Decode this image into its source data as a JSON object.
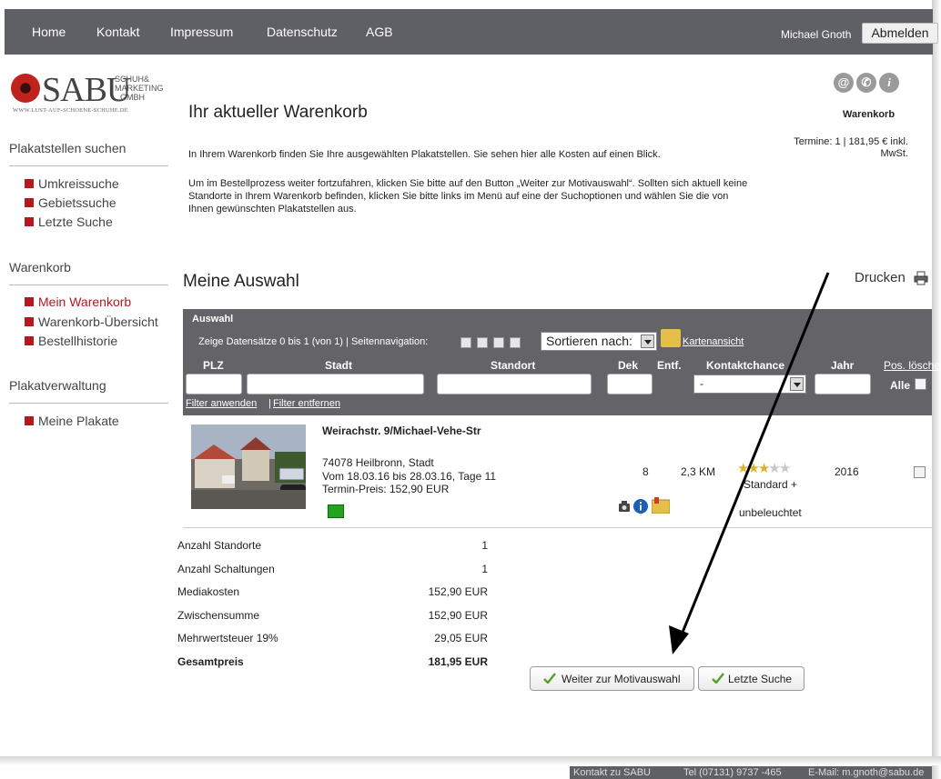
{
  "nav": {
    "items": [
      "Home",
      "Kontakt",
      "Impressum",
      "Datenschutz",
      "AGB"
    ],
    "user": "Michael Gnoth",
    "logout": "Abmelden"
  },
  "logo": {
    "brand": "SABU",
    "sub1": "SCHUH&",
    "sub2": "MARKETING",
    "sub3": "GMBH",
    "url": "WWW.LUST-AUF-SCHOENE-SCHUHE.DE"
  },
  "sidebar": {
    "search_heading": "Plakatstellen suchen",
    "search_items": [
      "Umkreissuche",
      "Gebietssuche",
      "Letzte Suche"
    ],
    "cart_heading": "Warenkorb",
    "cart_items": [
      "Mein Warenkorb",
      "Warenkorb-Übersicht",
      "Bestellhistorie"
    ],
    "admin_heading": "Plakatverwaltung",
    "admin_items": [
      "Meine Plakate"
    ]
  },
  "main": {
    "title": "Ihr aktueller Warenkorb",
    "intro1": "In Ihrem Warenkorb finden Sie Ihre ausgewählten Plakatstellen. Sie sehen hier alle Kosten auf einen Blick.",
    "intro2": "Um im Bestellprozess weiter fortzufahren, klicken Sie bitte auf den Button „Weiter zur Motivauswahl“. Sollten sich aktuell keine Standorte in Ihrem Warenkorb befinden, klicken Sie bitte links im Menü auf eine der Suchoptionen und wählen Sie die von Ihnen gewünschten Plakatstellen aus.",
    "cart_title": "Warenkorb",
    "cart_summary": "Termine: 1 | 181,95 € inkl. MwSt.",
    "selection_title": "Meine Auswahl",
    "print": "Drucken"
  },
  "table": {
    "header": "Auswahl",
    "records": "Zeige Datensätze 0 bis 1 (von 1) | Seitennavigation:",
    "sort_label": "Sortieren nach:",
    "map_view": "Kartenansicht",
    "columns": [
      "PLZ",
      "Stadt",
      "Standort",
      "Dek",
      "Entf.",
      "Kontaktchance",
      "Jahr",
      "Pos. löschen"
    ],
    "kontakt_value": "-",
    "all_label": "Alle",
    "filter_apply": "Filter anwenden",
    "filter_remove": "Filter entfernen",
    "filter_sep": "|"
  },
  "item": {
    "street": "Weirachstr. 9/Michael-Vehe-Str",
    "city": "74078 Heilbronn, Stadt",
    "dates": "Vom 18.03.16 bis 28.03.16, Tage 11",
    "price": "Termin-Preis: 152,90 EUR",
    "dek": "8",
    "entf": "2,3 KM",
    "rating": 3,
    "rating_max": 5,
    "standard": "Standard +",
    "lighting": "unbeleuchtet",
    "year": "2016"
  },
  "totals": [
    {
      "label": "Anzahl Standorte",
      "value": "1",
      "bold": false
    },
    {
      "label": "Anzahl Schaltungen",
      "value": "1",
      "bold": false
    },
    {
      "label": "Mediakosten",
      "value": "152,90 EUR",
      "bold": false
    },
    {
      "label": "Zwischensumme",
      "value": "152,90 EUR",
      "bold": false
    },
    {
      "label": "Mehrwertsteuer 19%",
      "value": "29,05 EUR",
      "bold": false
    },
    {
      "label": "Gesamtpreis",
      "value": "181,95 EUR",
      "bold": true
    }
  ],
  "buttons": {
    "next": "Weiter zur Motivauswahl",
    "last_search": "Letzte Suche"
  },
  "footer": {
    "contact": "Kontakt zu SABU",
    "phone": "Tel (07131) 9737 -465",
    "email": "E-Mail: m.gnoth@sabu.de"
  },
  "colors": {
    "nav_bg": "#5f5f66",
    "accent_red": "#b3191f",
    "table_head_bg": "#646468",
    "star_on": "#e2b126",
    "flag_green": "#22a322"
  },
  "icons": [
    "email-icon",
    "phone-icon",
    "info-icon",
    "print-icon",
    "map-icon",
    "camera-icon",
    "checkmark-icon"
  ]
}
